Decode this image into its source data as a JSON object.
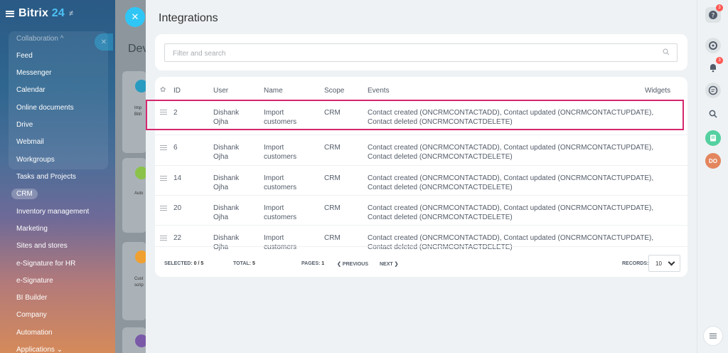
{
  "sidebar": {
    "brand": "Bitrix",
    "brand_num": "24",
    "pin_glyph": "≠",
    "collab_header": "Collaboration ^",
    "items": [
      "Feed",
      "Messenger",
      "Calendar",
      "Online documents",
      "Drive",
      "Webmail",
      "Workgroups",
      "Tasks and Projects"
    ],
    "crm": "CRM",
    "items2": [
      "Inventory management",
      "Marketing",
      "Sites and stores",
      "e-Signature for HR",
      "e-Signature",
      "BI Builder",
      "Company",
      "Automation",
      "Applications ⌄"
    ]
  },
  "bg": {
    "dev_title": "Dev",
    "card1_text": "Imp Bitri",
    "card2_text": "Auto",
    "card3_text": "Cust scrip"
  },
  "panel": {
    "title": "Integrations",
    "search_placeholder": "Filter and search",
    "columns": {
      "id": "ID",
      "user": "User",
      "name": "Name",
      "scope": "Scope",
      "events": "Events",
      "widgets": "Widgets"
    },
    "rows": [
      {
        "id": "2",
        "user1": "Dishank",
        "user2": "Ojha",
        "name1": "Import",
        "name2": "customers",
        "scope": "CRM",
        "ev1": "Contact created (ONCRMCONTACTADD), Contact updated (ONCRMCONTACTUPDATE),",
        "ev2": "Contact deleted (ONCRMCONTACTDELETE)"
      },
      {
        "id": "6",
        "user1": "Dishank",
        "user2": "Ojha",
        "name1": "Import",
        "name2": "customers",
        "scope": "CRM",
        "ev1": "Contact created (ONCRMCONTACTADD), Contact updated (ONCRMCONTACTUPDATE),",
        "ev2": "Contact deleted (ONCRMCONTACTDELETE)"
      },
      {
        "id": "14",
        "user1": "Dishank",
        "user2": "Ojha",
        "name1": "Import",
        "name2": "customers",
        "scope": "CRM",
        "ev1": "Contact created (ONCRMCONTACTADD), Contact updated (ONCRMCONTACTUPDATE),",
        "ev2": "Contact deleted (ONCRMCONTACTDELETE)"
      },
      {
        "id": "20",
        "user1": "Dishank",
        "user2": "Ojha",
        "name1": "Import",
        "name2": "customers",
        "scope": "CRM",
        "ev1": "Contact created (ONCRMCONTACTADD), Contact updated (ONCRMCONTACTUPDATE),",
        "ev2": "Contact deleted (ONCRMCONTACTDELETE)"
      },
      {
        "id": "22",
        "user1": "Dishank",
        "user2": "Ojha",
        "name1": "Import",
        "name2": "customers",
        "scope": "CRM",
        "ev1": "Contact created (ONCRMCONTACTADD), Contact updated (ONCRMCONTACTUPDATE),",
        "ev2": "Contact deleted (ONCRMCONTACTDELETE)"
      }
    ],
    "footer": {
      "selected_label": "Selected:",
      "selected_val": "0 / 5",
      "total_label": "Total:",
      "total_val": "5",
      "pages_label": "Pages:",
      "pages_val": "1",
      "prev": "❮ Previous",
      "next": "Next ❯",
      "records_label": "Records:",
      "records_val": "10"
    }
  },
  "rightbar": {
    "help_badge": "3",
    "bell_badge": "3",
    "avatar": "DO"
  },
  "colors": {
    "accent": "#2fc6f6",
    "highlight": "#d6266f",
    "badge": "#ff5752"
  }
}
